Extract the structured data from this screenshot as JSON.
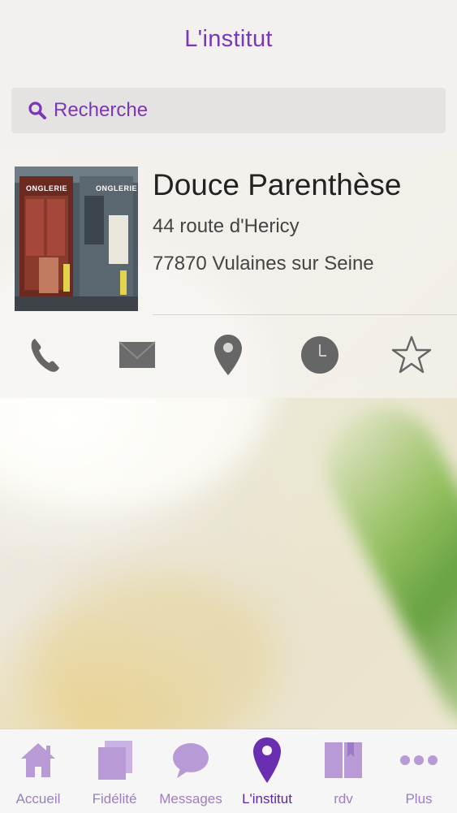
{
  "header": {
    "title": "L'institut"
  },
  "search": {
    "placeholder": "Recherche"
  },
  "institute": {
    "name": "Douce Parenthèse",
    "address_line1": "44 route d'Hericy",
    "address_line2": "77870 Vulaines sur Seine",
    "photo_signs": [
      "ONGLERIE",
      "ONGLERIE"
    ]
  },
  "actions": [
    {
      "icon": "phone-icon"
    },
    {
      "icon": "mail-icon"
    },
    {
      "icon": "map-pin-icon"
    },
    {
      "icon": "clock-icon"
    },
    {
      "icon": "star-icon"
    }
  ],
  "tabs": [
    {
      "label": "Accueil",
      "icon": "home-icon"
    },
    {
      "label": "Fidélité",
      "icon": "cards-icon"
    },
    {
      "label": "Messages",
      "icon": "chat-icon"
    },
    {
      "label": "L'institut",
      "icon": "map-pin-icon",
      "active": true
    },
    {
      "label": "rdv",
      "icon": "book-icon"
    },
    {
      "label": "Plus",
      "icon": "more-icon"
    }
  ],
  "colors": {
    "accent": "#7a37b8",
    "tab_icon": "#b79ad6",
    "active_tab": "#5c2a99"
  }
}
